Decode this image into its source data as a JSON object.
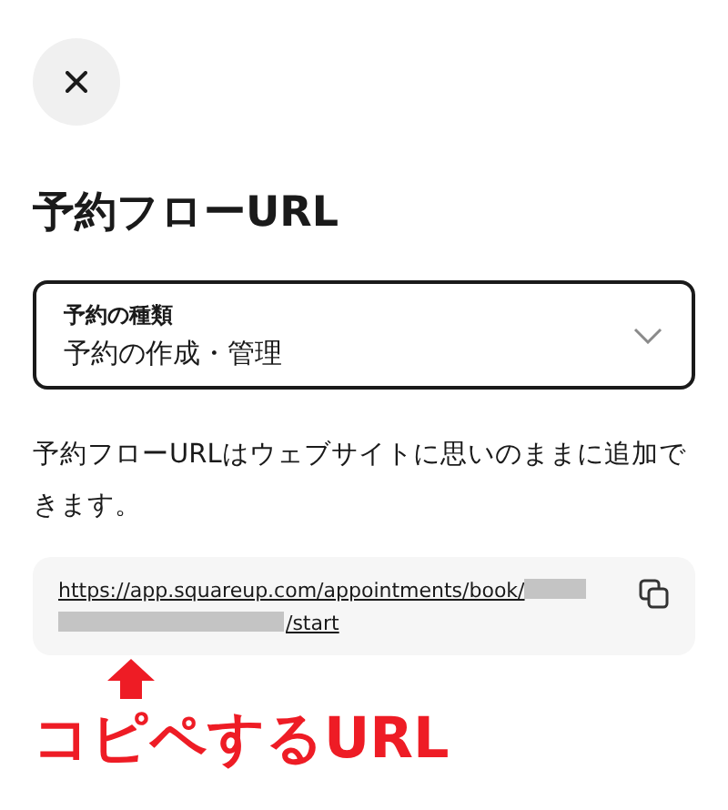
{
  "title": "予約フローURL",
  "select": {
    "label": "予約の種類",
    "value": "予約の作成・管理"
  },
  "description": "予約フローURLはウェブサイトに思いのままに追加できます。",
  "url": {
    "prefix": "https://app.squareup.com/appointments/book/",
    "suffix": "/start"
  },
  "annotation": "コピペするURL"
}
